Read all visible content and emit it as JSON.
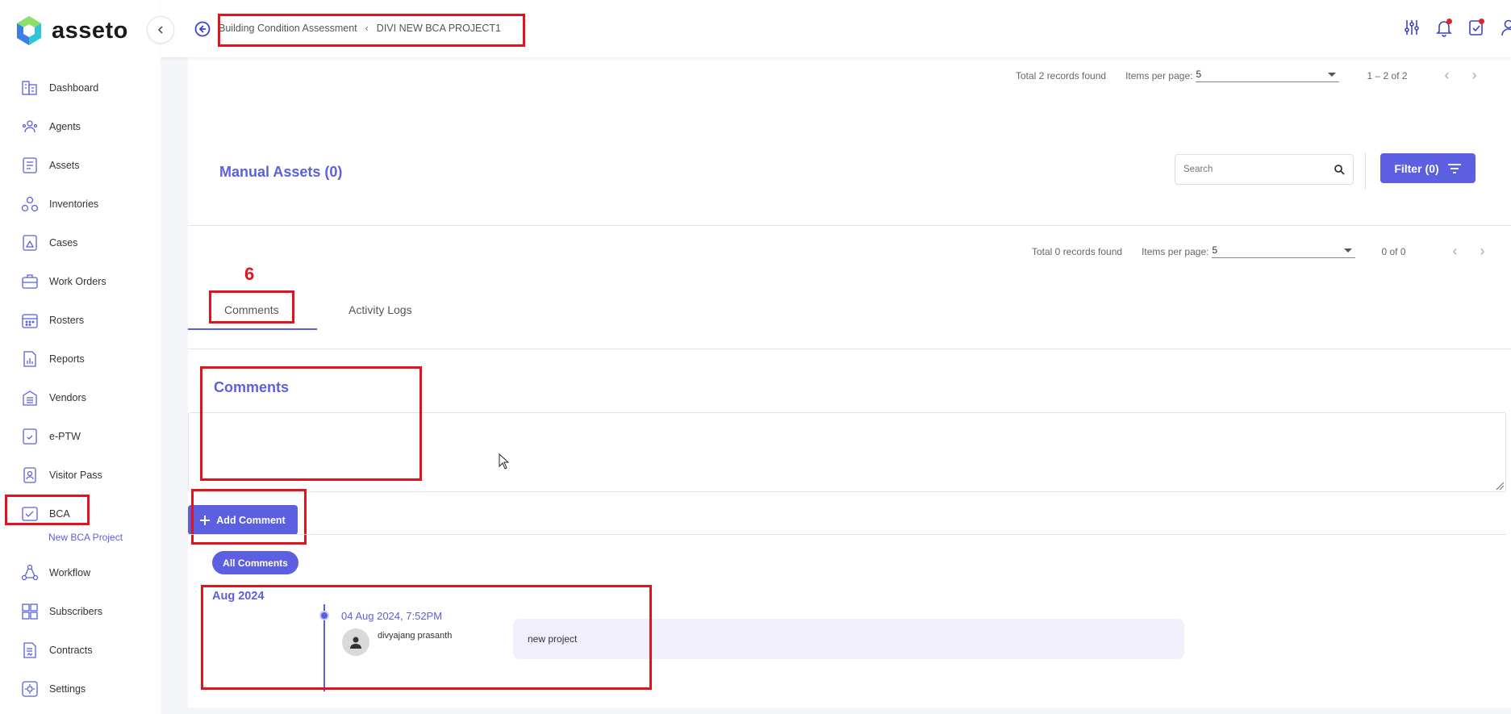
{
  "app": {
    "name": "asseto",
    "brand_color": "#5b5fe0",
    "annotation_color": "#e0141e"
  },
  "sidebar": {
    "items": [
      {
        "label": "Dashboard",
        "icon": "dashboard-icon"
      },
      {
        "label": "Agents",
        "icon": "agents-icon"
      },
      {
        "label": "Assets",
        "icon": "assets-icon"
      },
      {
        "label": "Inventories",
        "icon": "inventories-icon"
      },
      {
        "label": "Cases",
        "icon": "cases-icon"
      },
      {
        "label": "Work Orders",
        "icon": "work-orders-icon"
      },
      {
        "label": "Rosters",
        "icon": "rosters-icon"
      },
      {
        "label": "Reports",
        "icon": "reports-icon"
      },
      {
        "label": "Vendors",
        "icon": "vendors-icon"
      },
      {
        "label": "e-PTW",
        "icon": "eptw-icon"
      },
      {
        "label": "Visitor Pass",
        "icon": "visitor-pass-icon"
      },
      {
        "label": "BCA",
        "icon": "bca-icon"
      },
      {
        "label": "Workflow",
        "icon": "workflow-icon"
      },
      {
        "label": "Subscribers",
        "icon": "subscribers-icon"
      },
      {
        "label": "Contracts",
        "icon": "contracts-icon"
      },
      {
        "label": "Settings",
        "icon": "settings-icon"
      }
    ],
    "sub_item": "New BCA Project"
  },
  "header": {
    "breadcrumb": [
      "Building Condition Assessment",
      "DIVI NEW BCA PROJECT1"
    ],
    "icons": [
      "filter-sliders-icon",
      "notification-bell-icon",
      "tasks-icon",
      "user-icon"
    ]
  },
  "pager_top": {
    "total": "Total 2 records found",
    "ipp_label": "Items per page:",
    "ipp_value": "5",
    "range": "1 – 2 of 2"
  },
  "manual_assets": {
    "title": "Manual Assets (0)",
    "search_placeholder": "Search",
    "filter_label": "Filter",
    "filter_count": "(0)"
  },
  "pager_bottom": {
    "total": "Total 0 records found",
    "ipp_label": "Items per page:",
    "ipp_value": "5",
    "range": "0 of 0"
  },
  "tabs": {
    "annotation_number": "6",
    "items": [
      "Comments",
      "Activity Logs"
    ]
  },
  "comments": {
    "heading": "Comments",
    "add_button": "Add Comment",
    "all_button": "All Comments",
    "month": "Aug 2024",
    "entries": [
      {
        "date": "04 Aug 2024, 7:52PM",
        "user": "divyajang prasanth",
        "text": "new project"
      }
    ]
  }
}
